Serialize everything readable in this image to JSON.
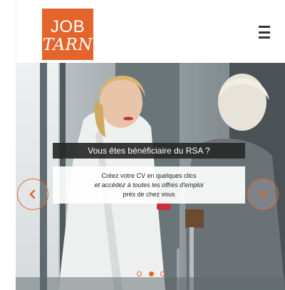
{
  "header": {
    "logo": {
      "line1": "JOB",
      "line2": "TARN"
    },
    "menu_icon": "hamburger-menu-icon"
  },
  "slider": {
    "title": "Vous êtes bénéficiaire du RSA ?",
    "text_line1": "Créez votre CV en quelques clics",
    "text_line2": "et accédez à toutes les offres d'emploi",
    "text_line3": "près de chez vous",
    "prev_icon": "chevron-left-icon",
    "next_icon": "chevron-right-icon",
    "dots_count": 3,
    "active_dot": 2
  },
  "colors": {
    "brand": "#e4652c",
    "dark_banner": "#282828",
    "menu": "#333333"
  }
}
